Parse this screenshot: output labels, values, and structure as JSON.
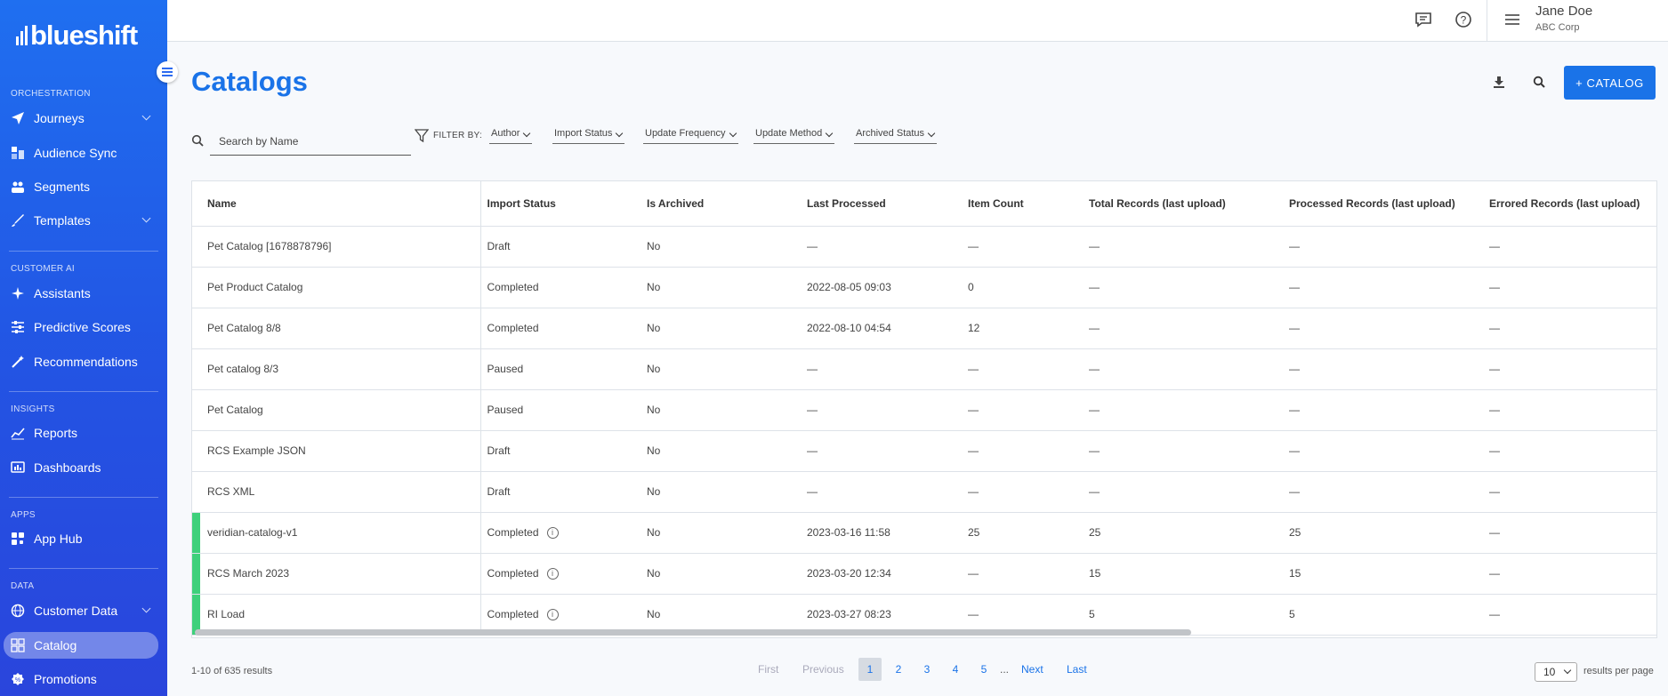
{
  "brand": {
    "logo_text": "blueshift"
  },
  "sidebar": {
    "sections": [
      {
        "label": "ORCHESTRATION"
      },
      {
        "label": "CUSTOMER AI"
      },
      {
        "label": "INSIGHTS"
      },
      {
        "label": "APPS"
      },
      {
        "label": "DATA"
      }
    ],
    "items": [
      {
        "label": "Journeys",
        "icon": "send-icon",
        "expandable": true
      },
      {
        "label": "Audience Sync",
        "icon": "sync-icon",
        "expandable": false
      },
      {
        "label": "Segments",
        "icon": "people-icon",
        "expandable": false
      },
      {
        "label": "Templates",
        "icon": "brush-icon",
        "expandable": true
      },
      {
        "label": "Assistants",
        "icon": "sparkle-icon",
        "expandable": false
      },
      {
        "label": "Predictive Scores",
        "icon": "sliders-icon",
        "expandable": false
      },
      {
        "label": "Recommendations",
        "icon": "magic-wand-icon",
        "expandable": false
      },
      {
        "label": "Reports",
        "icon": "trend-icon",
        "expandable": false
      },
      {
        "label": "Dashboards",
        "icon": "dashboard-icon",
        "expandable": false
      },
      {
        "label": "App Hub",
        "icon": "apps-icon",
        "expandable": false
      },
      {
        "label": "Customer Data",
        "icon": "globe-icon",
        "expandable": true
      },
      {
        "label": "Catalog",
        "icon": "catalog-icon",
        "expandable": false,
        "active": true
      },
      {
        "label": "Promotions",
        "icon": "promo-icon",
        "expandable": false
      }
    ]
  },
  "header": {
    "user_name": "Jane Doe",
    "user_org": "ABC Corp"
  },
  "page": {
    "title": "Catalogs",
    "add_button_label": "+ CATALOG"
  },
  "search": {
    "placeholder": "Search by Name"
  },
  "filters": {
    "label": "FILTER BY:",
    "options": [
      "Author",
      "Import Status",
      "Update Frequency",
      "Update Method",
      "Archived Status"
    ]
  },
  "table": {
    "columns": [
      "Name",
      "Import Status",
      "Is Archived",
      "Last Processed",
      "Item Count",
      "Total Records (last upload)",
      "Processed Records (last upload)",
      "Errored Records (last upload)"
    ],
    "rows": [
      {
        "name": "Pet Catalog [1678878796]",
        "status": "Draft",
        "archived": "No",
        "last_processed": "—",
        "item_count": "—",
        "total": "—",
        "processed": "—",
        "errored": "—",
        "info": false
      },
      {
        "name": "Pet Product Catalog",
        "status": "Completed",
        "archived": "No",
        "last_processed": "2022-08-05 09:03",
        "item_count": "0",
        "total": "—",
        "processed": "—",
        "errored": "—",
        "info": false
      },
      {
        "name": "Pet Catalog 8/8",
        "status": "Completed",
        "archived": "No",
        "last_processed": "2022-08-10 04:54",
        "item_count": "12",
        "total": "—",
        "processed": "—",
        "errored": "—",
        "info": false
      },
      {
        "name": "Pet catalog 8/3",
        "status": "Paused",
        "archived": "No",
        "last_processed": "—",
        "item_count": "—",
        "total": "—",
        "processed": "—",
        "errored": "—",
        "info": false
      },
      {
        "name": "Pet Catalog",
        "status": "Paused",
        "archived": "No",
        "last_processed": "—",
        "item_count": "—",
        "total": "—",
        "processed": "—",
        "errored": "—",
        "info": false
      },
      {
        "name": "RCS Example JSON",
        "status": "Draft",
        "archived": "No",
        "last_processed": "—",
        "item_count": "—",
        "total": "—",
        "processed": "—",
        "errored": "—",
        "info": false
      },
      {
        "name": "RCS XML",
        "status": "Draft",
        "archived": "No",
        "last_processed": "—",
        "item_count": "—",
        "total": "—",
        "processed": "—",
        "errored": "—",
        "info": false
      },
      {
        "name": "veridian-catalog-v1",
        "status": "Completed",
        "archived": "No",
        "last_processed": "2023-03-16 11:58",
        "item_count": "25",
        "total": "25",
        "processed": "25",
        "errored": "—",
        "info": true
      },
      {
        "name": "RCS March 2023",
        "status": "Completed",
        "archived": "No",
        "last_processed": "2023-03-20 12:34",
        "item_count": "—",
        "total": "15",
        "processed": "15",
        "errored": "—",
        "info": true
      },
      {
        "name": "RI Load",
        "status": "Completed",
        "archived": "No",
        "last_processed": "2023-03-27 08:23",
        "item_count": "—",
        "total": "5",
        "processed": "5",
        "errored": "—",
        "info": true
      }
    ]
  },
  "footer": {
    "results_text": "1-10 of 635 results",
    "pager": {
      "first": "First",
      "previous": "Previous",
      "pages": [
        "1",
        "2",
        "3",
        "4",
        "5"
      ],
      "current": "1",
      "ellipsis": "...",
      "next": "Next",
      "last": "Last"
    },
    "per_page_value": "10",
    "per_page_label": "results per page"
  },
  "colors": {
    "accent": "#1a73e8",
    "sidebar_top": "#1f6ff0",
    "sidebar_bottom": "#2a45dc",
    "success_marker": "#3ed07b"
  }
}
